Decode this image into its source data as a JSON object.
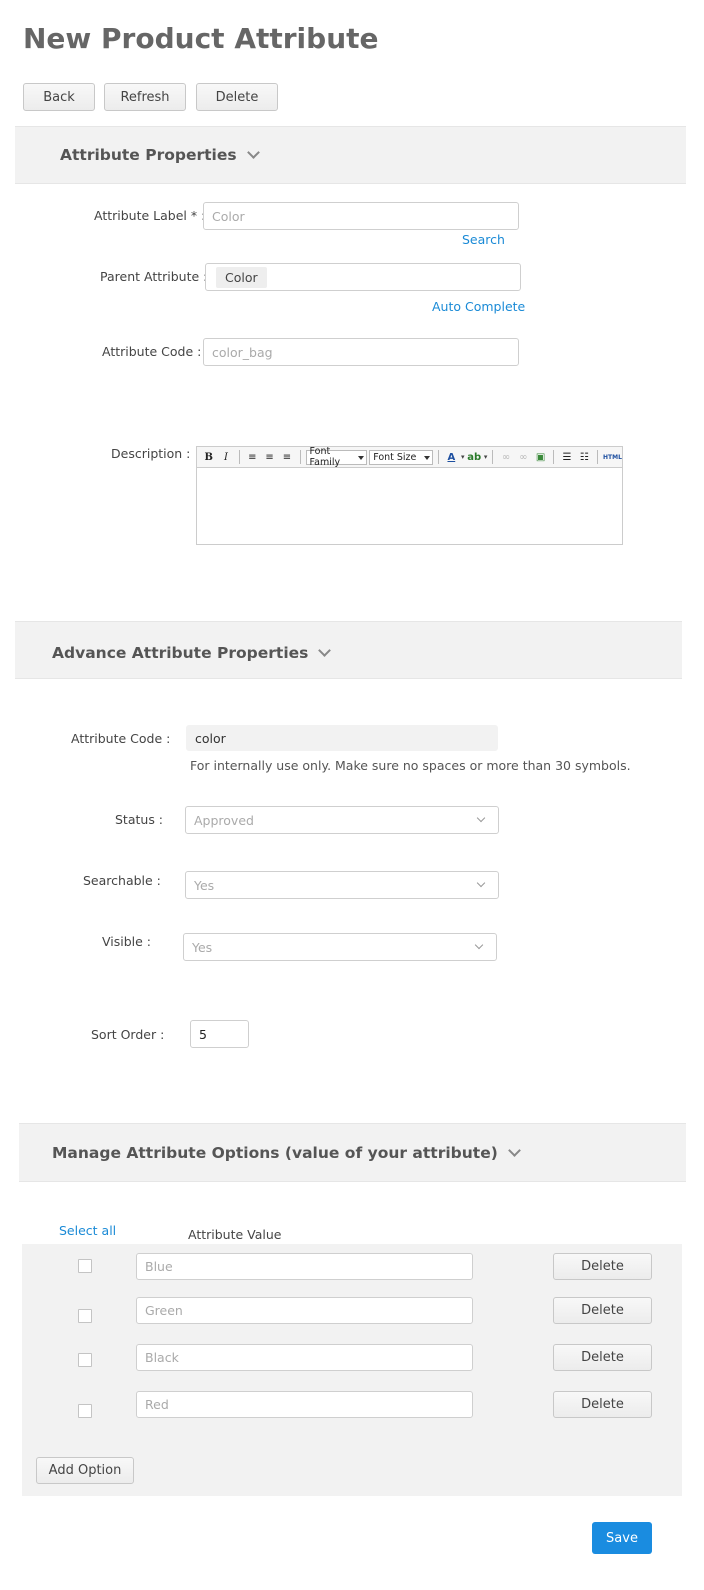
{
  "page": {
    "title": "New Product Attribute"
  },
  "top_buttons": {
    "back": "Back",
    "refresh": "Refresh",
    "delete": "Delete"
  },
  "attribute_properties": {
    "heading": "Attribute Properties",
    "label_label": "Attribute Label * :",
    "label_placeholder": "Color",
    "search_link": "Search",
    "parent_label": "Parent Attribute :",
    "parent_value": "Color",
    "autocomplete_link": "Auto Complete",
    "code_label": "Attribute Code :",
    "code_placeholder": "color_bag",
    "description_label": "Description :",
    "editor": {
      "font_family": "Font Family",
      "font_size": "Font Size",
      "html": "HTML"
    }
  },
  "advance_properties": {
    "heading": "Advance Attribute Properties",
    "code_label": "Attribute Code :",
    "code_value": "color",
    "code_help": "For internally use only. Make sure no spaces or more than 30 symbols.",
    "status_label": "Status :",
    "status_value": "Approved",
    "searchable_label": "Searchable :",
    "searchable_value": "Yes",
    "visible_label": "Visible :",
    "visible_value": "Yes",
    "sort_label": "Sort Order :",
    "sort_value": "5"
  },
  "options": {
    "heading": "Manage Attribute Options (value of your attribute)",
    "select_all": "Select all",
    "value_header": "Attribute Value",
    "rows": [
      {
        "value": "Blue",
        "delete": "Delete"
      },
      {
        "value": "Green",
        "delete": "Delete"
      },
      {
        "value": "Black",
        "delete": "Delete"
      },
      {
        "value": "Red",
        "delete": "Delete"
      }
    ],
    "add_option": "Add Option"
  },
  "footer": {
    "save": "Save"
  },
  "colors": {
    "accent": "#1a8ce0",
    "link": "#1a8ad6",
    "band": "#f2f2f2"
  }
}
